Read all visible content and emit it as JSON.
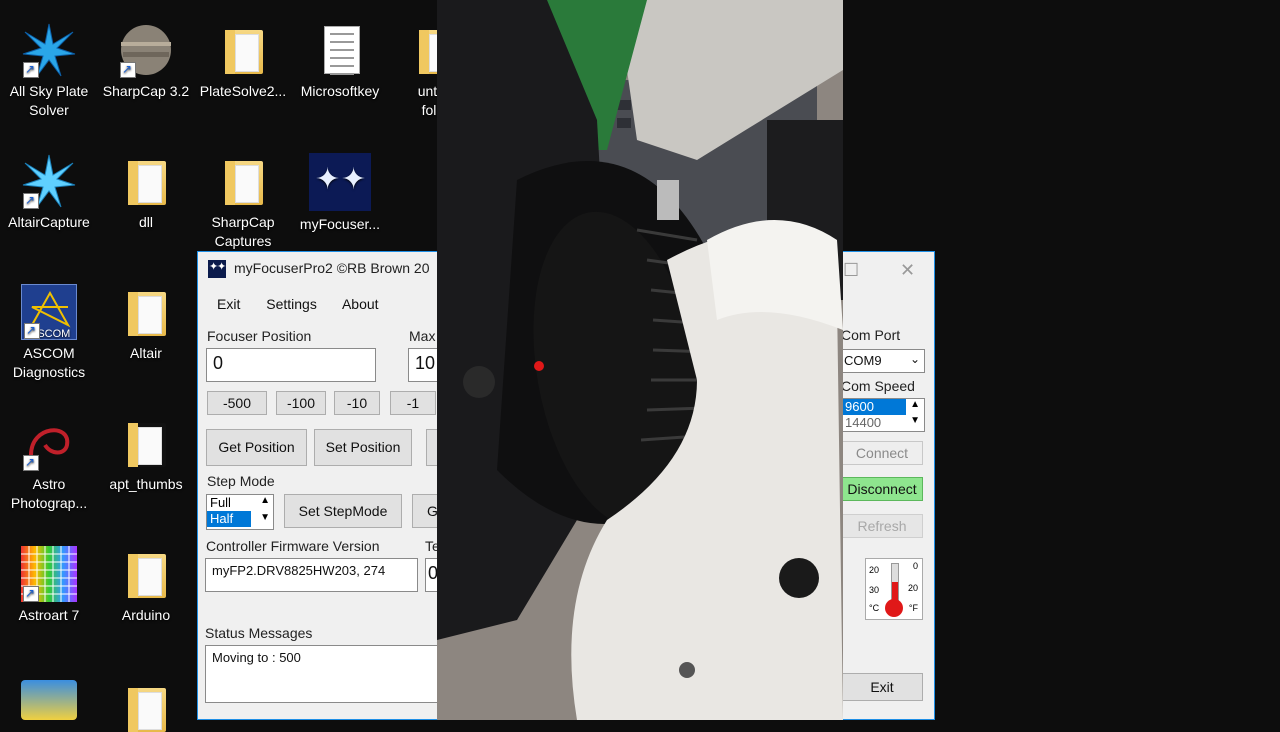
{
  "desktop": {
    "icons": [
      {
        "label": "All Sky Plate Solver",
        "icon": "starburst-icon"
      },
      {
        "label": "SharpCap 3.2",
        "icon": "planet-icon"
      },
      {
        "label": "PlateSolve2...",
        "icon": "folder-icon"
      },
      {
        "label": "Microsoftkey",
        "icon": "document-icon"
      },
      {
        "label": "unti fol",
        "icon": "folder-icon"
      },
      {
        "label": "AltairCapture",
        "icon": "starburst-icon"
      },
      {
        "label": "dll",
        "icon": "folder-icon"
      },
      {
        "label": "SharpCap Captures",
        "icon": "folder-icon"
      },
      {
        "label": "myFocuser...",
        "icon": "myfocuser-icon"
      },
      {
        "label": "ASCOM Diagnostics",
        "icon": "ascom-icon"
      },
      {
        "label": "Altair",
        "icon": "folder-icon"
      },
      {
        "label": "Astro Photograp...",
        "icon": "astro-icon"
      },
      {
        "label": "apt_thumbs",
        "icon": "folder-icon"
      },
      {
        "label": "Astroart 7",
        "icon": "grid-icon"
      },
      {
        "label": "Arduino",
        "icon": "folder-icon"
      }
    ]
  },
  "app": {
    "title": "myFocuserPro2 ©RB Brown 20",
    "menu": [
      "Exit",
      "Settings",
      "About"
    ],
    "focuser_position_label": "Focuser Position",
    "focuser_position_value": "0",
    "max_label": "Max",
    "max_value": "10",
    "step_buttons": [
      "-500",
      "-100",
      "-10",
      "-1"
    ],
    "get_position": "Get Position",
    "set_position": "Set Position",
    "step_mode_label": "Step Mode",
    "step_mode_options": [
      "Full",
      "Half"
    ],
    "step_mode_selected": "Half",
    "set_stepmode": "Set StepMode",
    "g_button": "G",
    "firmware_label": "Controller Firmware Version",
    "firmware_value": "myFP2.DRV8825HW203, 274",
    "te_label": "Te",
    "te_value": "0",
    "status_label": "Status Messages",
    "status_value": "Moving to : 500",
    "com_port_label": "Com Port",
    "com_port_value": "COM9",
    "com_speed_label": "Com Speed",
    "com_speed_options": [
      "9600",
      "14400"
    ],
    "connect": "Connect",
    "disconnect": "Disconnect",
    "refresh": "Refresh",
    "exit": "Exit",
    "thermometer": {
      "left": [
        "20",
        "30"
      ],
      "right": [
        "0",
        "20"
      ],
      "units_c": "°C",
      "units_f": "°F"
    }
  }
}
